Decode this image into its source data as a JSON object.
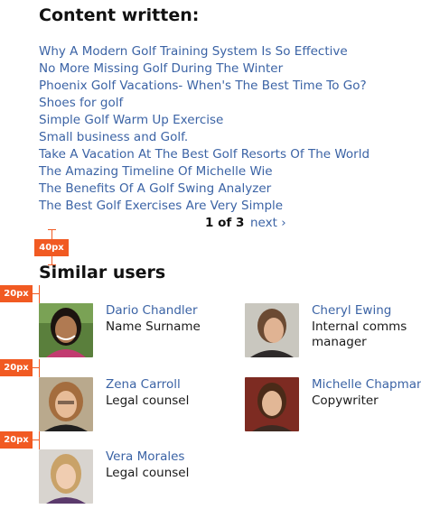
{
  "content_section": {
    "heading": "Content written:",
    "articles": [
      "Why A Modern Golf Training System Is So Effective",
      "No More Missing Golf During The Winter",
      "Phoenix Golf Vacations- When's The Best Time To Go?",
      "Shoes for golf",
      "Simple Golf Warm Up Exercise",
      "Small business and Golf.",
      "Take A Vacation At The Best Golf Resorts Of The World",
      "The Amazing Timeline Of Michelle Wie",
      "The Benefits Of A Golf Swing Analyzer",
      "The Best Golf Exercises Are Very Simple"
    ],
    "pagination": {
      "status": "1 of 3",
      "next_label": "next ›"
    }
  },
  "similar_section": {
    "heading": "Similar users",
    "users": [
      {
        "name": "Dario Chandler",
        "role": "Name Surname"
      },
      {
        "name": "Cheryl Ewing",
        "role": "Internal comms manager"
      },
      {
        "name": "Zena Carroll",
        "role": "Legal counsel"
      },
      {
        "name": "Michelle Chapman",
        "role": "Copywriter"
      },
      {
        "name": "Vera Morales",
        "role": "Legal counsel"
      }
    ]
  },
  "annotations": {
    "spacing_heading": "40px",
    "spacing_row_1": "20px",
    "spacing_row_2": "20px",
    "spacing_row_3": "20px"
  },
  "colors": {
    "link": "#3b63a5",
    "annotation": "#f15a22",
    "text": "#1a1a1a"
  }
}
